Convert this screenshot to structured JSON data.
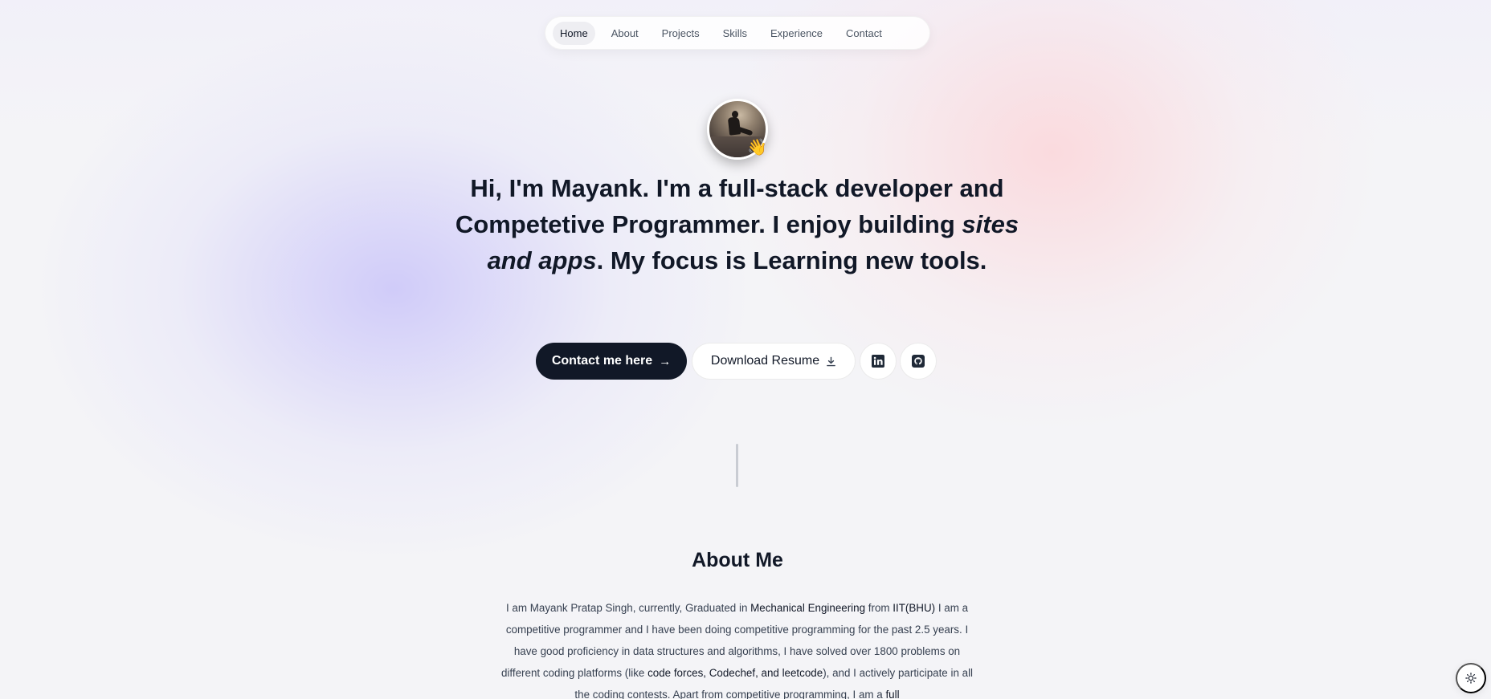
{
  "nav": {
    "items": [
      {
        "label": "Home",
        "active": true
      },
      {
        "label": "About",
        "active": false
      },
      {
        "label": "Projects",
        "active": false
      },
      {
        "label": "Skills",
        "active": false
      },
      {
        "label": "Experience",
        "active": false
      },
      {
        "label": "Contact",
        "active": false
      }
    ]
  },
  "hero": {
    "avatar_icon": "person-photo",
    "wave_emoji": "👋",
    "line": [
      {
        "text": "Hi, I'm Mayank.",
        "style": "bold"
      },
      {
        "text": " I'm a ",
        "style": "normal"
      },
      {
        "text": "full-stack developer",
        "style": "bold"
      },
      {
        "text": " and ",
        "style": "normal"
      },
      {
        "text": "Competetive Programmer",
        "style": "bold"
      },
      {
        "text": ". I enjoy building ",
        "style": "normal"
      },
      {
        "text": "sites and apps",
        "style": "bold-italic"
      },
      {
        "text": ". My focus is ",
        "style": "normal"
      },
      {
        "text": "Learning new tools.",
        "style": "bold"
      }
    ]
  },
  "cta": {
    "contact_label": "Contact me here",
    "contact_arrow": "→",
    "resume_label": "Download Resume",
    "linkedin_icon": "linkedin-icon",
    "github_icon": "github-icon"
  },
  "about": {
    "title": "About Me",
    "paragraph": [
      {
        "text": "I am Mayank Pratap Singh, currently, Graduated in ",
        "hl": false
      },
      {
        "text": "Mechanical Engineering",
        "hl": true
      },
      {
        "text": " from ",
        "hl": false
      },
      {
        "text": "IIT(BHU)",
        "hl": true
      },
      {
        "text": " I am a competitive programmer and I have been doing competitive programming for the past 2.5 years. I have good proficiency in data structures and algorithms, I have solved over 1800 problems on different coding platforms (like ",
        "hl": false
      },
      {
        "text": "code forces, Codechef, and leetcode",
        "hl": true
      },
      {
        "text": "), and I actively participate in all the coding contests. Apart from competitive programming, I am a ",
        "hl": false
      },
      {
        "text": "full",
        "hl": true
      }
    ]
  },
  "theme_toggle": {
    "icon": "sun-icon"
  },
  "colors": {
    "dark": "#111827",
    "text_muted": "#4b5563",
    "blob_violet": "#c4befa",
    "blob_pink": "#fcd4d8"
  }
}
